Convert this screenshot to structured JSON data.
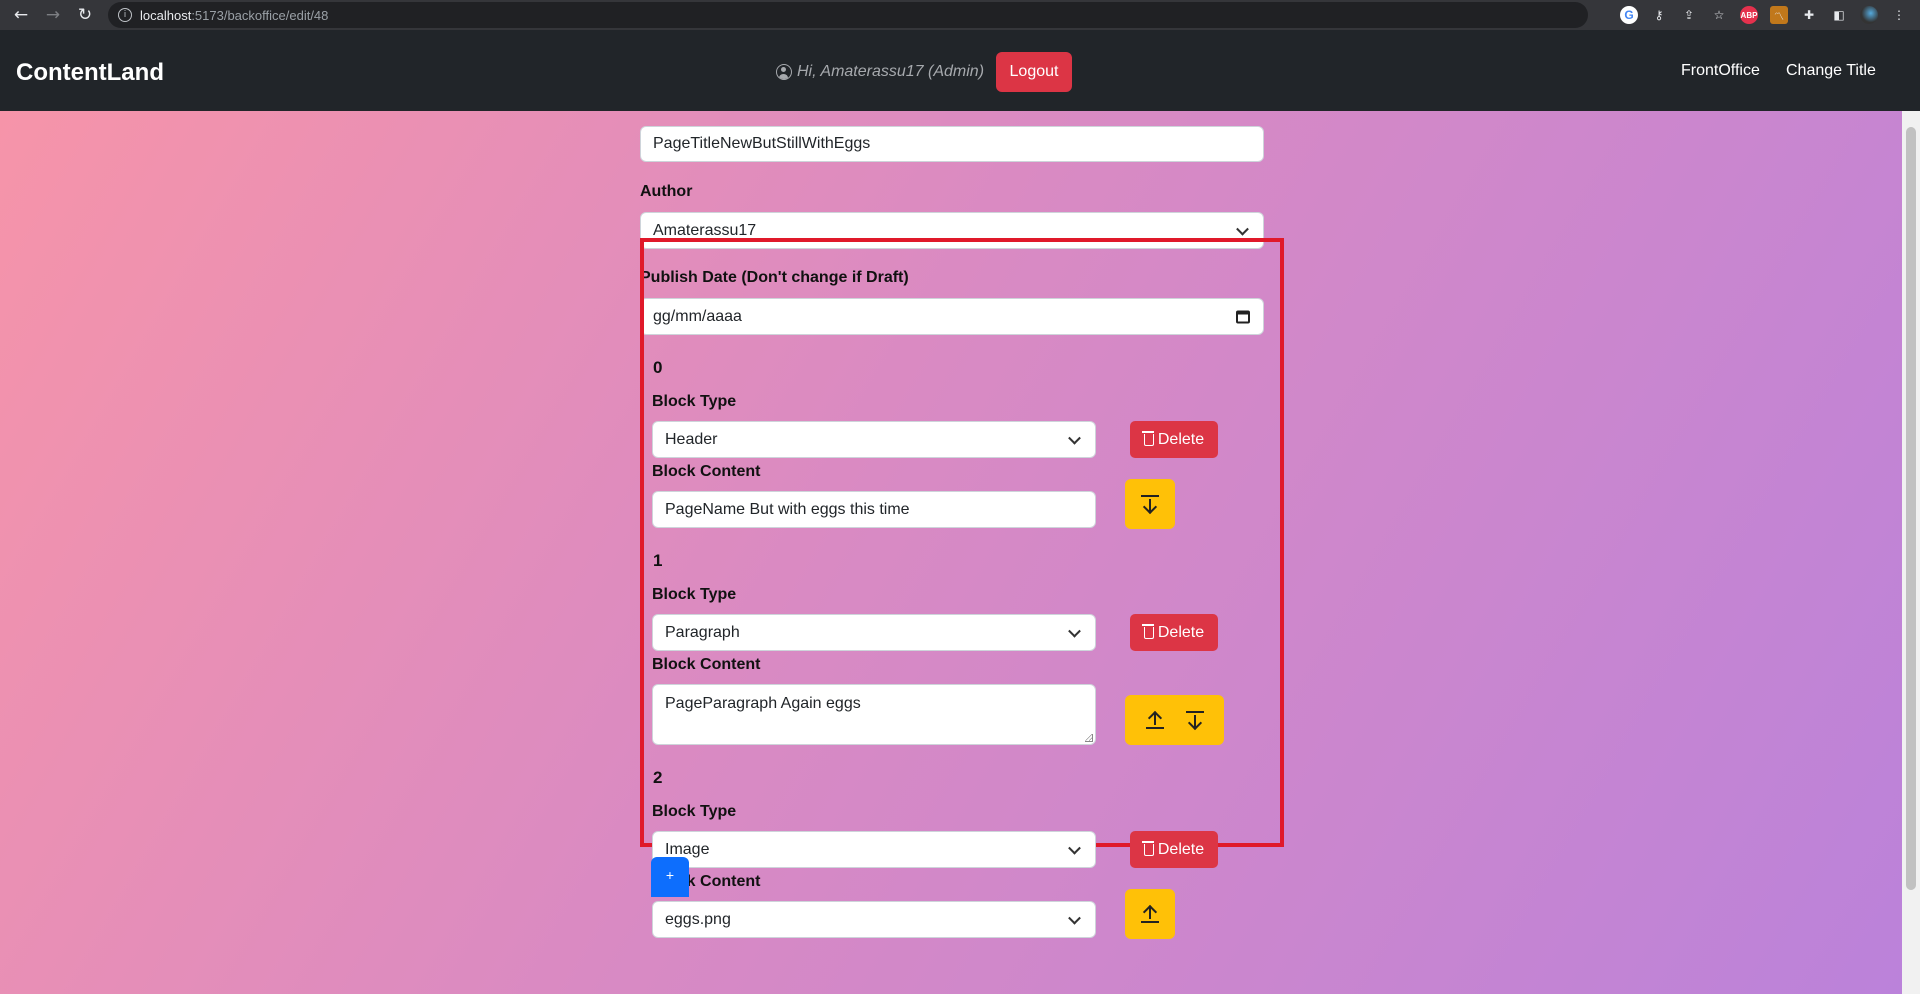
{
  "browser": {
    "url_host": "localhost",
    "url_path": ":5173/backoffice/edit/48",
    "back_icon": "←",
    "forward_icon": "→",
    "reload_icon": "↻",
    "info_icon": "i",
    "extensions": [
      "G",
      "⚷",
      "⇪",
      "☆",
      "ABP",
      "〽",
      "✚",
      "◧",
      "",
      "⋮"
    ]
  },
  "navbar": {
    "brand": "ContentLand",
    "greeting": "Hi, Amaterassu17 (Admin)",
    "logout_label": "Logout",
    "links": [
      "FrontOffice",
      "Change Title"
    ]
  },
  "form": {
    "title_value": "PageTitleNewButStillWithEggs",
    "author_label": "Author",
    "author_value": "Amaterassu17",
    "date_label": "Publish Date (Don't change if Draft)",
    "date_placeholder": "gg/mm/aaaa",
    "block_type_label": "Block Type",
    "block_content_label": "Block Content",
    "delete_label": "Delete",
    "add_label": "+"
  },
  "blocks": [
    {
      "index": "0",
      "type": "Header",
      "content": "PageName But with eggs this time",
      "content_kind": "text",
      "moves": [
        "down"
      ]
    },
    {
      "index": "1",
      "type": "Paragraph",
      "content": "PageParagraph Again eggs",
      "content_kind": "textarea",
      "moves": [
        "up",
        "down"
      ]
    },
    {
      "index": "2",
      "type": "Image",
      "content": "eggs.png",
      "content_kind": "select",
      "moves": [
        "up"
      ]
    }
  ],
  "colors": {
    "delete": "#dc3545",
    "move": "#ffc107",
    "add": "#0d6efd",
    "highlight": "#e0192a",
    "navbar": "#212529"
  }
}
